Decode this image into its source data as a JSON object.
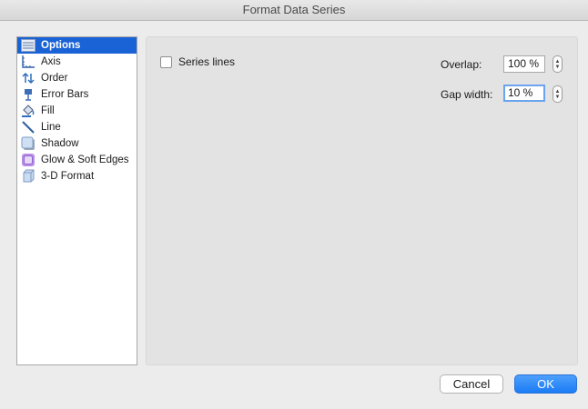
{
  "window": {
    "title": "Format Data Series"
  },
  "sidebar": {
    "items": [
      {
        "label": "Options",
        "icon": "options-icon",
        "selected": true
      },
      {
        "label": "Axis",
        "icon": "axis-icon",
        "selected": false
      },
      {
        "label": "Order",
        "icon": "order-icon",
        "selected": false
      },
      {
        "label": "Error Bars",
        "icon": "error-bars-icon",
        "selected": false
      },
      {
        "label": "Fill",
        "icon": "fill-bucket-icon",
        "selected": false
      },
      {
        "label": "Line",
        "icon": "line-icon",
        "selected": false
      },
      {
        "label": "Shadow",
        "icon": "shadow-icon",
        "selected": false
      },
      {
        "label": "Glow & Soft Edges",
        "icon": "glow-icon",
        "selected": false
      },
      {
        "label": "3-D Format",
        "icon": "3d-format-icon",
        "selected": false
      }
    ]
  },
  "options": {
    "series_lines_label": "Series lines",
    "series_lines_checked": false,
    "overlap_label": "Overlap:",
    "overlap_value": "100 %",
    "gap_width_label": "Gap width:",
    "gap_width_value": "10 %"
  },
  "buttons": {
    "cancel_label": "Cancel",
    "ok_label": "OK"
  },
  "colors": {
    "accent": "#1a63d6",
    "ok_button": "#1b7cf5"
  }
}
